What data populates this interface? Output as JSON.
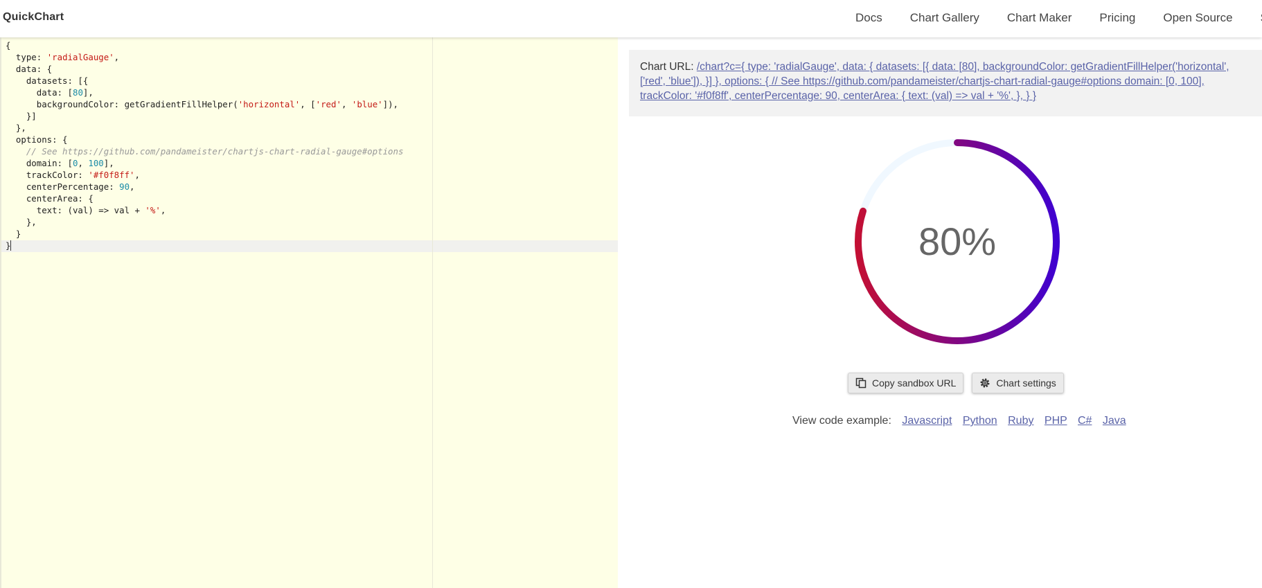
{
  "header": {
    "logo": "QuickChart",
    "nav": [
      "Docs",
      "Chart Gallery",
      "Chart Maker",
      "Pricing",
      "Open Source",
      "Support"
    ]
  },
  "editor": {
    "lines": [
      [
        {
          "t": "{",
          "c": ""
        }
      ],
      [
        {
          "t": "  type: ",
          "c": ""
        },
        {
          "t": "'radialGauge'",
          "c": "str"
        },
        {
          "t": ",",
          "c": ""
        }
      ],
      [
        {
          "t": "  data: {",
          "c": ""
        }
      ],
      [
        {
          "t": "    datasets: [{",
          "c": ""
        }
      ],
      [
        {
          "t": "      data: [",
          "c": ""
        },
        {
          "t": "80",
          "c": "num"
        },
        {
          "t": "],",
          "c": ""
        }
      ],
      [
        {
          "t": "      backgroundColor: getGradientFillHelper(",
          "c": ""
        },
        {
          "t": "'horizontal'",
          "c": "str"
        },
        {
          "t": ", [",
          "c": ""
        },
        {
          "t": "'red'",
          "c": "str"
        },
        {
          "t": ", ",
          "c": ""
        },
        {
          "t": "'blue'",
          "c": "str"
        },
        {
          "t": "]),",
          "c": ""
        }
      ],
      [
        {
          "t": "    }]",
          "c": ""
        }
      ],
      [
        {
          "t": "  },",
          "c": ""
        }
      ],
      [
        {
          "t": "  options: {",
          "c": ""
        }
      ],
      [
        {
          "t": "    // See https://github.com/pandameister/chartjs-chart-radial-gauge#options",
          "c": "com"
        }
      ],
      [
        {
          "t": "    domain: [",
          "c": ""
        },
        {
          "t": "0",
          "c": "num"
        },
        {
          "t": ", ",
          "c": ""
        },
        {
          "t": "100",
          "c": "num"
        },
        {
          "t": "],",
          "c": ""
        }
      ],
      [
        {
          "t": "    trackColor: ",
          "c": ""
        },
        {
          "t": "'#f0f8ff'",
          "c": "str"
        },
        {
          "t": ",",
          "c": ""
        }
      ],
      [
        {
          "t": "    centerPercentage: ",
          "c": ""
        },
        {
          "t": "90",
          "c": "num"
        },
        {
          "t": ",",
          "c": ""
        }
      ],
      [
        {
          "t": "    centerArea: {",
          "c": ""
        }
      ],
      [
        {
          "t": "      text: (val) => val + ",
          "c": ""
        },
        {
          "t": "'%'",
          "c": "str"
        },
        {
          "t": ",",
          "c": ""
        }
      ],
      [
        {
          "t": "    },",
          "c": ""
        }
      ],
      [
        {
          "t": "  }",
          "c": ""
        }
      ],
      [
        {
          "t": "}",
          "c": ""
        }
      ]
    ]
  },
  "preview": {
    "url_label": "Chart URL:",
    "url_text": "/chart?c={ type: 'radialGauge', data: { datasets: [{ data: [80], backgroundColor: getGradientFillHelper('horizontal', ['red', 'blue']), }] }, options: { // See https://github.com/pandameister/chartjs-chart-radial-gauge#options domain: [0, 100], trackColor: '#f0f8ff', centerPercentage: 90, centerArea: { text: (val) => val + '%', }, } }",
    "gauge": {
      "value": 80,
      "domain": [
        0,
        100
      ],
      "text": "80%",
      "track_color": "#f0f8ff",
      "gradient": [
        "#c8102e",
        "#3a00d6"
      ]
    },
    "buttons": {
      "copy": "Copy sandbox URL",
      "settings": "Chart settings"
    },
    "code_example_label": "View code example:",
    "languages": [
      "Javascript",
      "Python",
      "Ruby",
      "PHP",
      "C#",
      "Java"
    ]
  }
}
